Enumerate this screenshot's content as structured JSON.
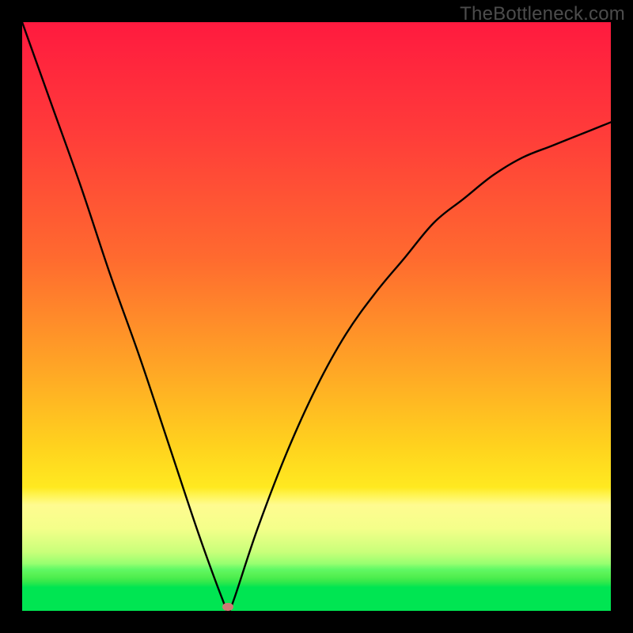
{
  "watermark": "TheBottleneck.com",
  "chart_data": {
    "type": "line",
    "title": "",
    "xlabel": "",
    "ylabel": "",
    "xlim": [
      0,
      100
    ],
    "ylim": [
      0,
      100
    ],
    "grid": false,
    "legend": false,
    "series": [
      {
        "name": "bottleneck-curve",
        "x": [
          0,
          5,
          10,
          15,
          20,
          25,
          30,
          34,
          35,
          36,
          40,
          45,
          50,
          55,
          60,
          65,
          70,
          75,
          80,
          85,
          90,
          95,
          100
        ],
        "values": [
          100,
          86,
          72,
          57,
          43,
          28,
          13,
          2,
          0,
          2,
          14,
          27,
          38,
          47,
          54,
          60,
          66,
          70,
          74,
          77,
          79,
          81,
          83
        ]
      }
    ],
    "annotations": [
      {
        "name": "minimum-marker",
        "x": 35,
        "y": 0.7
      }
    ],
    "background_gradient_stops": [
      {
        "pos": 0,
        "color": "#ff1a3f"
      },
      {
        "pos": 40,
        "color": "#ff6a2f"
      },
      {
        "pos": 72,
        "color": "#ffd21e"
      },
      {
        "pos": 82,
        "color": "#fff321"
      },
      {
        "pos": 90,
        "color": "#c9ff7a"
      },
      {
        "pos": 96,
        "color": "#00e552"
      },
      {
        "pos": 100,
        "color": "#00e552"
      }
    ],
    "curve_color": "#000000",
    "marker_color": "#cd7a74"
  }
}
